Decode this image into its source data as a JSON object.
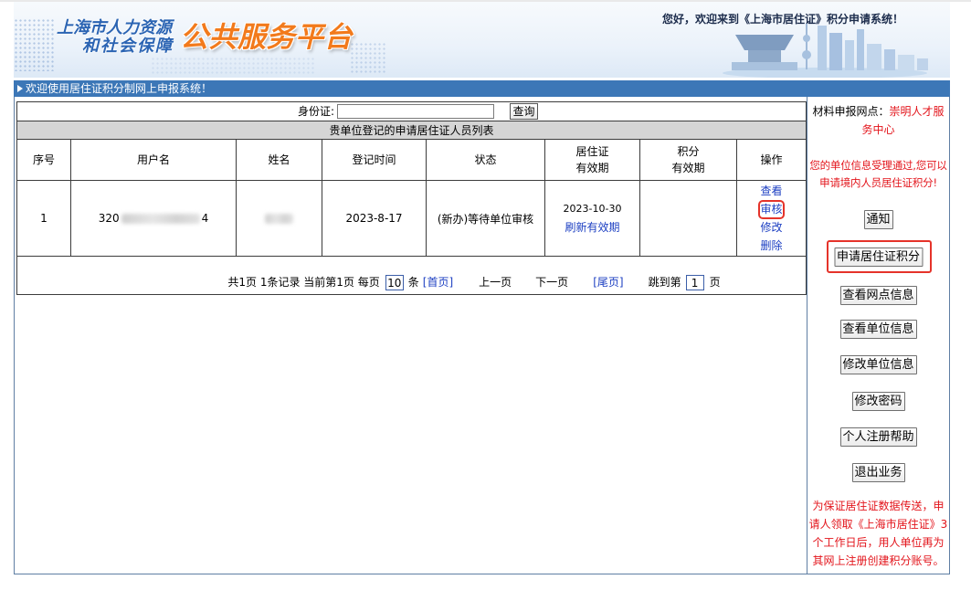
{
  "header": {
    "logo_line1": "上海市人力资源",
    "logo_line2": "和社会保障",
    "brand": "公共服务平台",
    "welcome": "您好，欢迎来到《上海市居住证》积分申请系统！"
  },
  "banner": {
    "icon": "triangle-right-icon",
    "text": "欢迎使用居住证积分制网上申报系统！"
  },
  "search": {
    "label": "身份证:",
    "value": "",
    "button": "查询"
  },
  "table": {
    "title": "贵单位登记的申请居住证人员列表",
    "columns": [
      {
        "line1": "序号"
      },
      {
        "line1": "用户名"
      },
      {
        "line1": "姓名"
      },
      {
        "line1": "登记时间"
      },
      {
        "line1": "状态"
      },
      {
        "line1": "居住证",
        "line2": "有效期"
      },
      {
        "line1": "积分",
        "line2": "有效期"
      },
      {
        "line1": "操作"
      }
    ],
    "rows": [
      {
        "index": "1",
        "username_prefix": "320",
        "username_suffix": "4",
        "registered": "2023-8-17",
        "status": "(新办)等待单位审核",
        "permit_validity": "2023-10-30",
        "refresh_link": "刷新有效期",
        "actions": [
          "查看",
          "审核",
          "修改",
          "删除"
        ]
      }
    ]
  },
  "pager": {
    "summary": "共1页 1条记录 当前第1页 每页",
    "per_page": "10",
    "per_page_unit": "条",
    "first": "[首页]",
    "prev": "上一页",
    "next": "下一页",
    "last": "[尾页]",
    "jump_label": "跳到第",
    "jump_value": "1",
    "jump_unit": "页"
  },
  "sidebar": {
    "outlet_label": "材料申报网点：",
    "outlet_name": "崇明人才服务中心",
    "notice": "您的单位信息受理通过,您可以申请境内人员居住证积分!",
    "buttons": [
      "通知",
      "申请居住证积分",
      "查看网点信息",
      "查看单位信息",
      "修改单位信息",
      "修改密码",
      "个人注册帮助",
      "退出业务"
    ],
    "footnote": "为保证居住证数据传送，申请人领取《上海市居住证》3个工作日后，用人单位再为其网上注册创建积分账号。"
  },
  "colors": {
    "banner_bg": "#3c77b7",
    "link": "#1c3fc2",
    "alert_red": "#e3141b",
    "highlight_red": "#e5332a",
    "brand_orange": "#f27a1c",
    "logo_blue": "#2b64b3"
  }
}
